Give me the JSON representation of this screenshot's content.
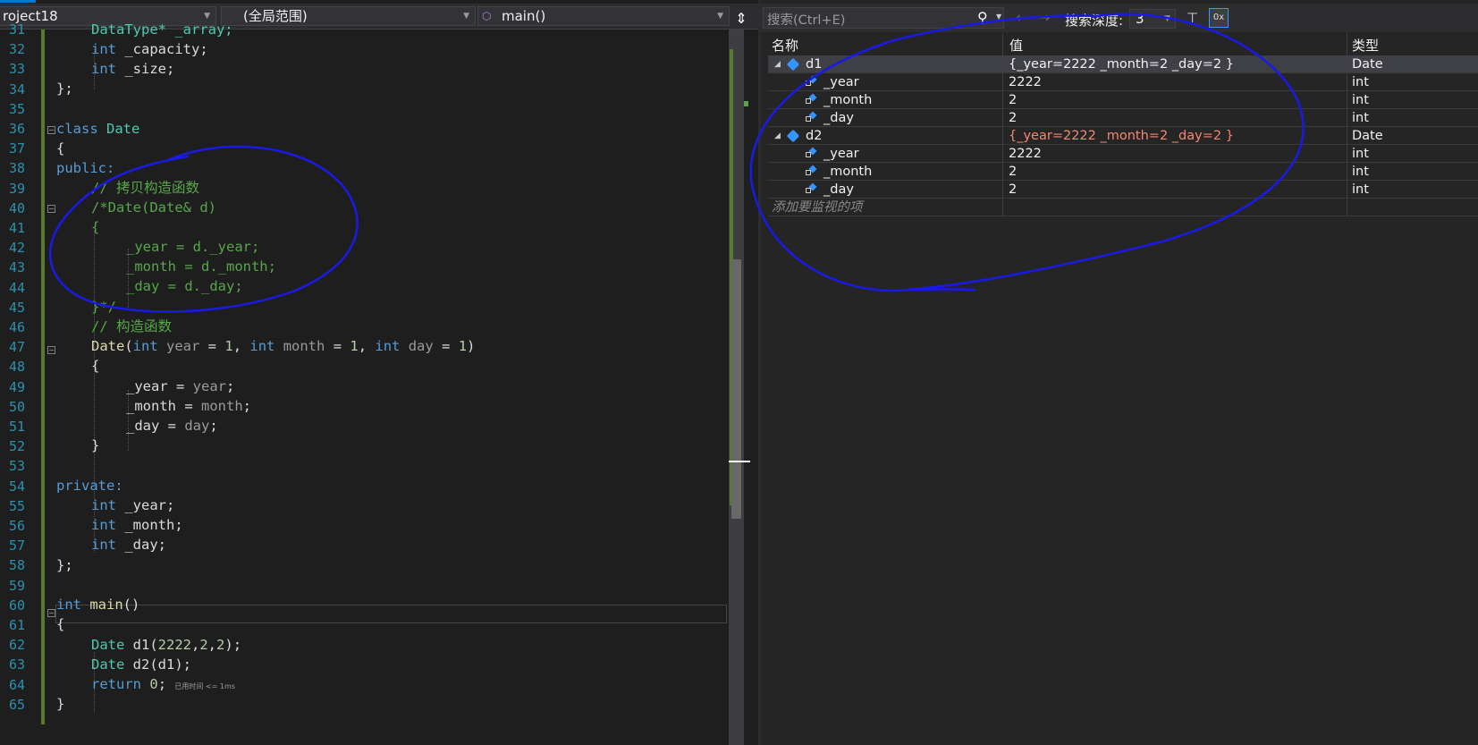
{
  "editor": {
    "project_selector": "roject18",
    "scope_selector": "(全局范围)",
    "function_selector": "main()",
    "split_icon": "split-handle-icon",
    "line_numbers": [
      "31",
      "32",
      "33",
      "34",
      "35",
      "36",
      "37",
      "38",
      "39",
      "40",
      "41",
      "42",
      "43",
      "44",
      "45",
      "46",
      "47",
      "48",
      "49",
      "50",
      "51",
      "52",
      "53",
      "54",
      "55",
      "56",
      "57",
      "58",
      "59",
      "60",
      "61",
      "62",
      "63",
      "64",
      "65"
    ],
    "code": {
      "l31a": "DataType* _array;",
      "l32a": "int",
      "l32b": " _capacity;",
      "l33a": "int",
      "l33b": " _size;",
      "l34": "};",
      "l36a": "class",
      "l36b": " Date",
      "l37": "{",
      "l38": "public:",
      "l39": "// 拷贝构造函数",
      "l40": "/*Date(Date& d)",
      "l41": "{",
      "l42": "_year = d._year;",
      "l43": "_month = d._month;",
      "l44": "_day = d._day;",
      "l45": "}*/",
      "l46": "// 构造函数",
      "l47_fn": "Date",
      "l47_p1": "(",
      "l47_int1": "int",
      "l47_year": " year",
      "l47_eq1": " = ",
      "l47_n1": "1",
      "l47_c1": ", ",
      "l47_int2": "int",
      "l47_month": " month",
      "l47_eq2": " = ",
      "l47_n2": "1",
      "l47_c2": ", ",
      "l47_int3": "int",
      "l47_day": " day",
      "l47_eq3": " = ",
      "l47_n3": "1",
      "l47_p2": ")",
      "l48": "{",
      "l49a": "_year",
      "l49b": " = ",
      "l49c": "year",
      "l49d": ";",
      "l50a": "_month",
      "l50b": " = ",
      "l50c": "month",
      "l50d": ";",
      "l51a": "_day",
      "l51b": " = ",
      "l51c": "day",
      "l51d": ";",
      "l52": "}",
      "l54": "private:",
      "l55a": "int",
      "l55b": " _year;",
      "l56a": "int",
      "l56b": " _month;",
      "l57a": "int",
      "l57b": " _day;",
      "l58": "};",
      "l60a": "int",
      "l60b": " main",
      "l60c": "()",
      "l61": "{",
      "l62a": "Date",
      "l62b": " d1(",
      "l62c": "2222",
      "l62d": ",",
      "l62e": "2",
      "l62f": ",",
      "l62g": "2",
      "l62h": ");",
      "l63a": "Date",
      "l63b": " d2(d1);",
      "l64a": "return",
      "l64b": " ",
      "l64c": "0",
      "l64d": ";",
      "l64_elapsed": "已用时间 <= 1ms",
      "l65": "}"
    }
  },
  "watch": {
    "search_placeholder": "搜索(Ctrl+E)",
    "search_depth_label": "搜索深度:",
    "search_depth_value": "3",
    "columns": {
      "name": "名称",
      "value": "值",
      "type": "类型"
    },
    "rows": [
      {
        "name": "d1",
        "value": "{_year=2222 _month=2 _day=2 }",
        "type": "Date"
      },
      {
        "name": "_year",
        "value": "2222",
        "type": "int"
      },
      {
        "name": "_month",
        "value": "2",
        "type": "int"
      },
      {
        "name": "_day",
        "value": "2",
        "type": "int"
      },
      {
        "name": "d2",
        "value": "{_year=2222 _month=2 _day=2 }",
        "type": "Date"
      },
      {
        "name": "_year",
        "value": "2222",
        "type": "int"
      },
      {
        "name": "_month",
        "value": "2",
        "type": "int"
      },
      {
        "name": "_day",
        "value": "2",
        "type": "int"
      }
    ],
    "add_item_placeholder": "添加要监视的项"
  },
  "colors": {
    "keyword": "#569cd6",
    "type": "#4ec9b0",
    "comment": "#57a64a",
    "function": "#dcdcaa",
    "number": "#b5cea8",
    "changed_value": "#f48771",
    "annotation_ink": "#1a1ae6"
  }
}
